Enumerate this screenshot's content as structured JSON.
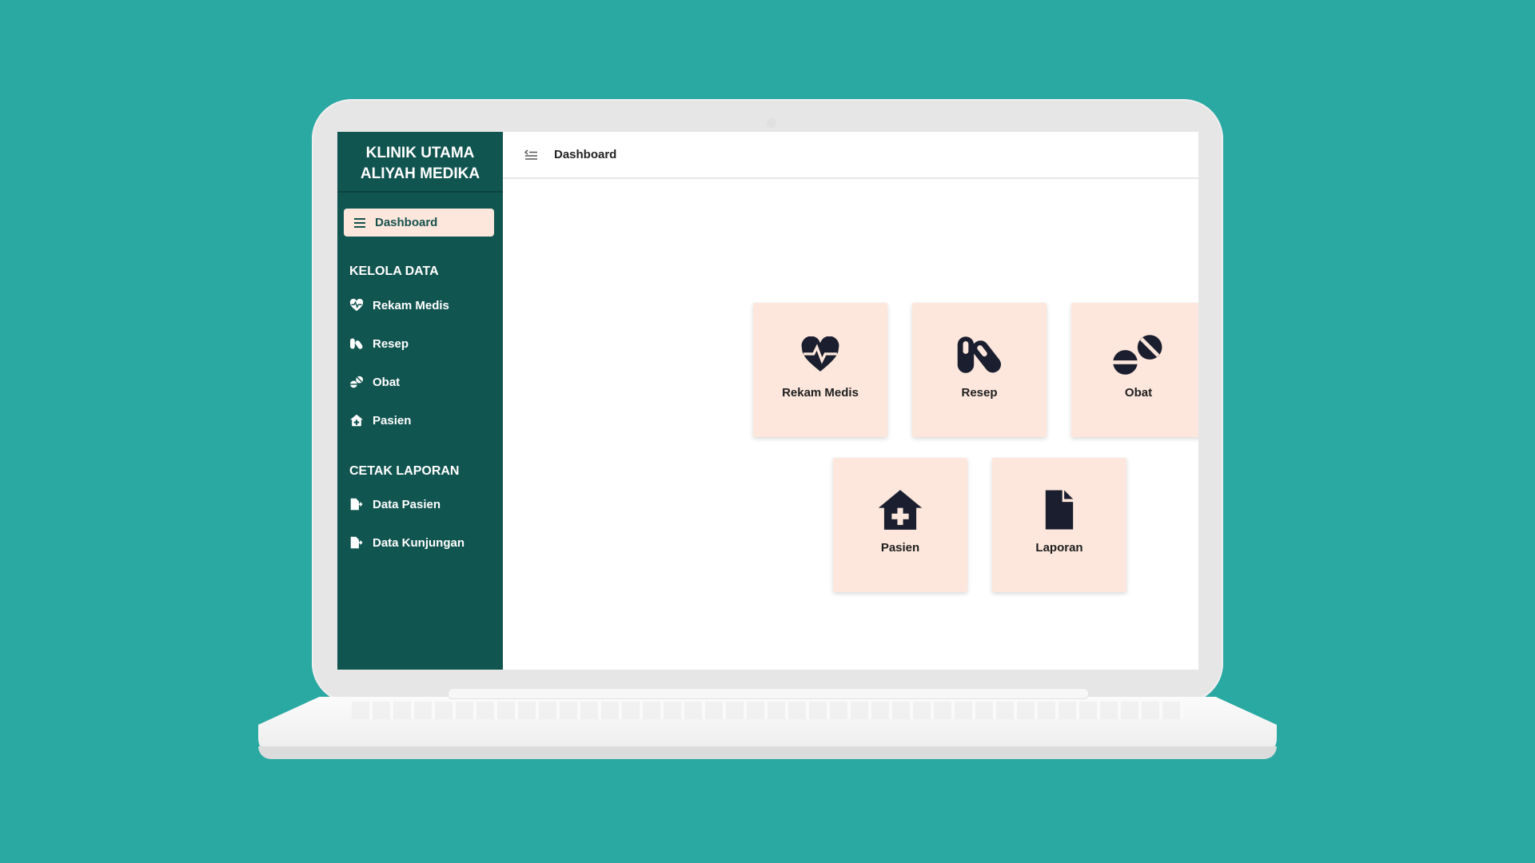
{
  "colors": {
    "background": "#2aa8a2",
    "sidebar": "#115551",
    "active_item": "#fde7dc",
    "card": "#fde7dc",
    "icon": "#1b1e2e"
  },
  "sidebar": {
    "brand_line1": "KLINIK UTAMA",
    "brand_line2": "ALIYAH MEDIKA",
    "active": {
      "label": "Dashboard",
      "icon": "bars-icon"
    },
    "section1": {
      "title": "KELOLA DATA",
      "items": [
        {
          "label": "Rekam Medis",
          "icon": "heart-pulse-icon"
        },
        {
          "label": "Resep",
          "icon": "pills-icon"
        },
        {
          "label": "Obat",
          "icon": "tablets-icon"
        },
        {
          "label": "Pasien",
          "icon": "house-medical-icon"
        }
      ]
    },
    "section2": {
      "title": "CETAK LAPORAN",
      "items": [
        {
          "label": "Data Pasien",
          "icon": "file-export-icon"
        },
        {
          "label": "Data Kunjungan",
          "icon": "file-export-icon"
        }
      ]
    }
  },
  "topbar": {
    "toggle_icon": "sidebar-toggle-icon",
    "title": "Dashboard"
  },
  "cards": [
    {
      "label": "Rekam Medis",
      "icon": "heart-pulse-icon"
    },
    {
      "label": "Resep",
      "icon": "pills-icon"
    },
    {
      "label": "Obat",
      "icon": "tablets-icon"
    },
    {
      "label": "Pasien",
      "icon": "house-medical-icon"
    },
    {
      "label": "Laporan",
      "icon": "file-icon"
    }
  ]
}
